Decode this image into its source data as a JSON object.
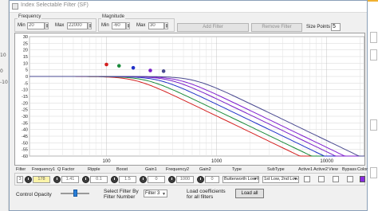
{
  "window": {
    "title": "Index Selectable Filter (SF)"
  },
  "frequency": {
    "group_label": "Frequency",
    "min_label": "Min",
    "min_value": "20",
    "max_label": "Max",
    "max_value": "22000"
  },
  "magnitude": {
    "group_label": "Magnitude",
    "min_label": "Min",
    "min_value": "-60",
    "max_label": "Max",
    "max_value": "30"
  },
  "buttons": {
    "add_filter": "Add Filter",
    "remove_filter": "Remove Filter",
    "load_all": "Load all"
  },
  "size_points": {
    "label": "Size Points",
    "value": "5"
  },
  "chart_data": {
    "type": "line",
    "x_scale": "log",
    "xlim": [
      20,
      22000
    ],
    "ylim": [
      -60,
      30
    ],
    "x_tick_labels": [
      "100",
      "1000",
      "10000"
    ],
    "y_ticks": [
      30,
      25,
      20,
      15,
      10,
      5,
      0,
      -5,
      -10,
      -15,
      -20,
      -25,
      -30,
      -35,
      -40,
      -45,
      -50,
      -55,
      -60
    ],
    "grid": true,
    "series": [
      {
        "color": "#d42020",
        "cutoff_hz": 180,
        "marker_x": 100,
        "marker_y": 9
      },
      {
        "color": "#1a8a3a",
        "cutoff_hz": 230,
        "marker_x": 130,
        "marker_y": 8
      },
      {
        "color": "#2030c8",
        "cutoff_hz": 300,
        "marker_x": 175,
        "marker_y": 6.5
      },
      {
        "color": "#7a20c8",
        "cutoff_hz": 380,
        "marker_x": 250,
        "marker_y": 4.5
      },
      {
        "color": "#8020d0",
        "cutoff_hz": 460,
        "marker_x": 0,
        "marker_y": 0
      },
      {
        "color": "#4a4a90",
        "cutoff_hz": 620,
        "marker_x": 330,
        "marker_y": 4
      }
    ]
  },
  "table": {
    "headers": [
      "Filter",
      "Frequency1",
      "Q Factor",
      "Ripple",
      "Boost",
      "Gain1",
      "Frequency2",
      "Gain2",
      "Type",
      "SubType",
      "Active1",
      "Active2",
      "View",
      "Bypass",
      "Color"
    ],
    "row": {
      "index": "3",
      "frequency1": "178",
      "q_factor": "1.41",
      "ripple": "0.1",
      "boost": "1.5",
      "gain1": "0",
      "frequency2": "1000",
      "gain2": "0",
      "type": "Butterworth Low Pass",
      "subtype": "1st Low, 2nd Low"
    },
    "colors": {
      "swatch": "#8a2be2"
    }
  },
  "bottom": {
    "control_opacity_label": "Control Opacity",
    "opacity_value": 0.5,
    "select_filter_label_1": "Select Filter By",
    "select_filter_label_2": "Filter Number",
    "select_filter_value": "Filter 3",
    "load_coeff_label_1": "Load coefficients",
    "load_coeff_label_2": "for all filters"
  }
}
